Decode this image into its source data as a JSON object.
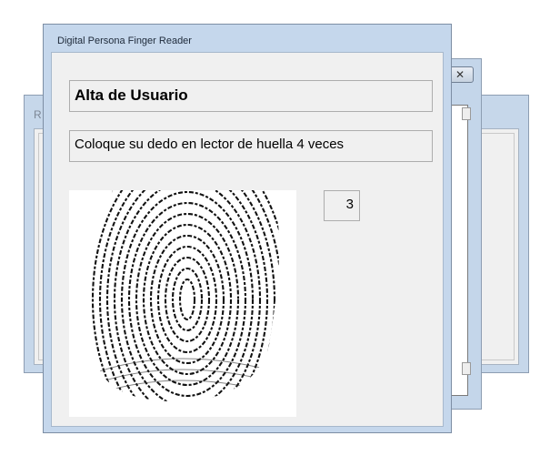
{
  "background_windows": {
    "left": {
      "title_fragment": "R"
    },
    "middle": {
      "close_glyph": "✕"
    }
  },
  "main_window": {
    "title": "Digital Persona Finger Reader",
    "heading": "Alta de Usuario",
    "instruction": "Coloque su dedo en lector de huella 4 veces",
    "counter": "3"
  }
}
